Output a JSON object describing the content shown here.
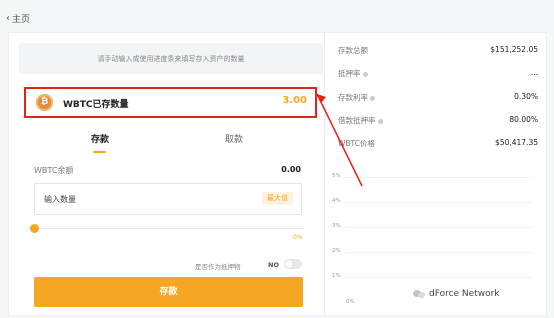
{
  "nav": {
    "back_chevron": "‹",
    "back_label": "主页"
  },
  "form": {
    "hint": "请手动输入或使用进度条来填写存入资产的数量",
    "asset": {
      "icon": "bitcoin-icon",
      "icon_glyph": "₿",
      "label": "WBTC已存数量",
      "value": "3.00"
    },
    "tabs": [
      {
        "label": "存款",
        "active": true
      },
      {
        "label": "取款",
        "active": false
      }
    ],
    "balance": {
      "label": "WBTC余额",
      "value": "0.00"
    },
    "amount": {
      "placeholder": "输入数量",
      "value": "",
      "max_label": "最大值"
    },
    "slider": {
      "percent_label": "0%",
      "fraction": 0
    },
    "collateral": {
      "label": "是否作为抵押物",
      "state_label": "NO",
      "enabled": false
    },
    "submit_label": "存款"
  },
  "stats": [
    {
      "label": "存款总额",
      "value": "$151,252.05",
      "info": false
    },
    {
      "label": "抵押率",
      "value": "...",
      "info": true
    },
    {
      "label": "存款利率",
      "value": "0.30%",
      "info": true
    },
    {
      "label": "借款抵押率",
      "value": "80.00%",
      "info": true
    },
    {
      "label": "WBTC价格",
      "value": "$50,417.35",
      "info": false
    }
  ],
  "chart": {
    "y_ticks": [
      "5%",
      "4%",
      "3%",
      "2%",
      "1%",
      "0%"
    ]
  },
  "watermark": "dForce Network",
  "colors": {
    "accent": "#f5a623",
    "highlight_border": "#e2231a",
    "coin": "#e08c3a"
  }
}
